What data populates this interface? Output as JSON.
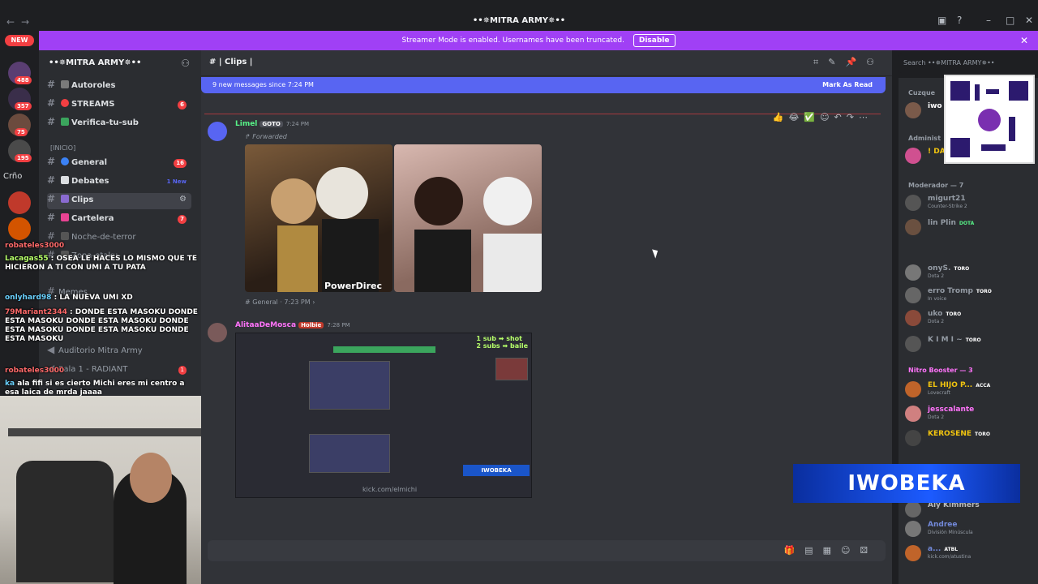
{
  "window": {
    "title": "••✵MITRA ARMY✵••",
    "nav_back": "←",
    "nav_forward": "→"
  },
  "streamer_bar": {
    "text": "Streamer Mode is enabled. Usernames have been truncated.",
    "button": "Disable",
    "close": "✕"
  },
  "servers": {
    "new_label": "NEW",
    "badges": [
      "488",
      "357",
      "75",
      "195"
    ],
    "text_item": "Crño"
  },
  "sidebar": {
    "guild_name": "••✵MITRA ARMY✵••",
    "channels": [
      {
        "label": "Autoroles"
      },
      {
        "label": "STREAMS",
        "badge": "6"
      },
      {
        "label": "Verifica-tu-sub"
      },
      {
        "label": "General",
        "badge": "16"
      },
      {
        "label": "Debates",
        "new": "1 New"
      },
      {
        "label": "Clips"
      },
      {
        "label": "Cartelera",
        "badge": "7"
      },
      {
        "label": "Noche-de-terror"
      },
      {
        "label": "Zona-otaku-"
      },
      {
        "label": "Memes"
      },
      {
        "label": "Auditorio Mitra Army"
      },
      {
        "label": "Sala 1 - RADIANT",
        "badge": "1"
      }
    ],
    "category": "[INICIO]"
  },
  "chat_overlay": [
    {
      "user": "robateles3000",
      "text": ""
    },
    {
      "user": "Lacagas55",
      "text": "OSEA LE HACES LO MISMO QUE TE HICIERON A TI CON UMI A TU PATA"
    },
    {
      "user": "onlyhard98",
      "text": "LA NUEVA UMI XD"
    },
    {
      "user": "79Mariant2344",
      "text": "DONDE ESTA MASOKU DONDE ESTA MASOKU DONDE ESTA MASOKU DONDE ESTA MASOKU DONDE ESTA MASOKU DONDE ESTA MASOKU"
    },
    {
      "user": "robateles3000",
      "text": ""
    },
    {
      "user": "ka",
      "text": "ala fifi si es cierto Michi eres mi centro a esa laica de mrda jaaaa"
    }
  ],
  "channel": {
    "name": "Clips",
    "search_placeholder": "Search ••✵MITRA ARMY✵••",
    "new_messages": "9 new messages since 7:24 PM",
    "mark_as_read": "Mark As Read"
  },
  "messages": [
    {
      "author": "Limel",
      "tag": "GOTO",
      "time": "7:24 PM",
      "forwarded": "Forwarded",
      "source": "# General",
      "source_time": "7:23 PM",
      "watermark": "PowerDirec"
    },
    {
      "author": "AlitaaDeMosca",
      "tag": "Holbie",
      "time": "7:28 PM",
      "clip_sub": "1 sub ➡ shot",
      "clip_sub2": "2 subs ➡ baile",
      "clip_tag": "IWOBEKA",
      "clip_url": "kick.com/elmichi"
    }
  ],
  "members": {
    "categories": [
      {
        "label": "Cuzque"
      },
      {
        "label": "Administ"
      },
      {
        "label": "Moderador — 7"
      },
      {
        "label": "Nitro Booster — 3"
      }
    ],
    "list": [
      {
        "name": "iwo",
        "status": ""
      },
      {
        "name": "! DA",
        "status": ""
      },
      {
        "name": "migurt21",
        "status": "Counter-Strike 2"
      },
      {
        "name": "lin Plin",
        "status": "",
        "pill": "DOTA"
      },
      {
        "name": "onyS.",
        "status": "Dota 2",
        "pill": "TORO"
      },
      {
        "name": "erro Tromp",
        "status": "In voice",
        "pill": "TORO"
      },
      {
        "name": "uko",
        "status": "Dota 2",
        "pill": "TORO"
      },
      {
        "name": "K I M I ~",
        "status": "",
        "pill": "TORO"
      },
      {
        "name": "EL HIJO P...",
        "status": "Lovecraft",
        "pill": "ACCA"
      },
      {
        "name": "jesscalante",
        "status": "Dota 2"
      },
      {
        "name": "KEROSENE",
        "status": "",
        "pill": "TORO"
      },
      {
        "name": "Aly Kimmers",
        "status": ""
      },
      {
        "name": "Andree",
        "status": "División Minúscula"
      },
      {
        "name": "a...",
        "status": "kick.com/atustina",
        "pill": "ATBL"
      }
    ]
  },
  "overlay": {
    "banner": "IWOBEKA"
  },
  "colors": {
    "accent": "#5865f2",
    "streamer": "#a040f5",
    "danger": "#f23f42"
  }
}
